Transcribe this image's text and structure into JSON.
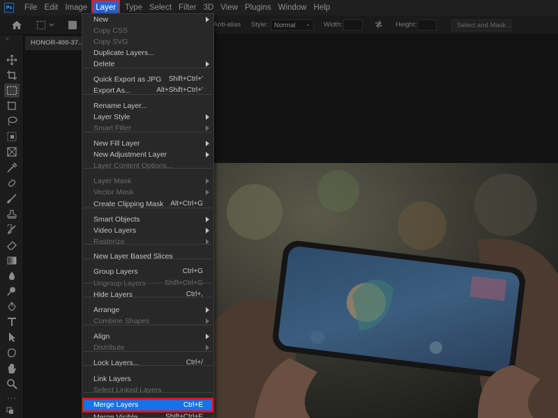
{
  "menubar": {
    "logo": "Ps",
    "items": [
      "File",
      "Edit",
      "Image",
      "Layer",
      "Type",
      "Select",
      "Filter",
      "3D",
      "View",
      "Plugins",
      "Window",
      "Help"
    ],
    "active_item": "Layer"
  },
  "options_bar": {
    "anti_alias_label": "Anti-alias",
    "style_label": "Style:",
    "style_value": "Normal",
    "width_label": "Width:",
    "height_label": "Height:",
    "select_mask_label": "Select and Mask..."
  },
  "document": {
    "tab_title": "HONOR-400-37..."
  },
  "layer_menu": {
    "items": [
      {
        "label": "New",
        "shortcut": "",
        "submenu": true,
        "disabled": false
      },
      {
        "label": "Copy CSS",
        "shortcut": "",
        "submenu": false,
        "disabled": true
      },
      {
        "label": "Copy SVG",
        "shortcut": "",
        "submenu": false,
        "disabled": true
      },
      {
        "label": "Duplicate Layers...",
        "shortcut": "",
        "submenu": false,
        "disabled": false
      },
      {
        "label": "Delete",
        "shortcut": "",
        "submenu": true,
        "disabled": false
      },
      {
        "label": "Quick Export as JPG",
        "shortcut": "Shift+Ctrl+'",
        "submenu": false,
        "disabled": false
      },
      {
        "label": "Export As...",
        "shortcut": "Alt+Shift+Ctrl+'",
        "submenu": false,
        "disabled": false
      },
      {
        "label": "Rename Layer...",
        "shortcut": "",
        "submenu": false,
        "disabled": false
      },
      {
        "label": "Layer Style",
        "shortcut": "",
        "submenu": true,
        "disabled": false
      },
      {
        "label": "Smart Filter",
        "shortcut": "",
        "submenu": true,
        "disabled": true
      },
      {
        "label": "New Fill Layer",
        "shortcut": "",
        "submenu": true,
        "disabled": false
      },
      {
        "label": "New Adjustment Layer",
        "shortcut": "",
        "submenu": true,
        "disabled": false
      },
      {
        "label": "Layer Content Options...",
        "shortcut": "",
        "submenu": false,
        "disabled": true
      },
      {
        "label": "Layer Mask",
        "shortcut": "",
        "submenu": true,
        "disabled": true
      },
      {
        "label": "Vector Mask",
        "shortcut": "",
        "submenu": true,
        "disabled": true
      },
      {
        "label": "Create Clipping Mask",
        "shortcut": "Alt+Ctrl+G",
        "submenu": false,
        "disabled": false
      },
      {
        "label": "Smart Objects",
        "shortcut": "",
        "submenu": true,
        "disabled": false
      },
      {
        "label": "Video Layers",
        "shortcut": "",
        "submenu": true,
        "disabled": false
      },
      {
        "label": "Rasterize",
        "shortcut": "",
        "submenu": true,
        "disabled": true
      },
      {
        "label": "New Layer Based Slices",
        "shortcut": "",
        "submenu": false,
        "disabled": false
      },
      {
        "label": "Group Layers",
        "shortcut": "Ctrl+G",
        "submenu": false,
        "disabled": false
      },
      {
        "label": "Ungroup Layers",
        "shortcut": "Shift+Ctrl+G",
        "submenu": false,
        "disabled": true
      },
      {
        "label": "Hide Layers",
        "shortcut": "Ctrl+,",
        "submenu": false,
        "disabled": false
      },
      {
        "label": "Arrange",
        "shortcut": "",
        "submenu": true,
        "disabled": false
      },
      {
        "label": "Combine Shapes",
        "shortcut": "",
        "submenu": true,
        "disabled": true
      },
      {
        "label": "Align",
        "shortcut": "",
        "submenu": true,
        "disabled": false
      },
      {
        "label": "Distribute",
        "shortcut": "",
        "submenu": true,
        "disabled": true
      },
      {
        "label": "Lock Layers...",
        "shortcut": "Ctrl+/",
        "submenu": false,
        "disabled": false
      },
      {
        "label": "Link Layers",
        "shortcut": "",
        "submenu": false,
        "disabled": false
      },
      {
        "label": "Select Linked Layers",
        "shortcut": "",
        "submenu": false,
        "disabled": true
      },
      {
        "label": "Merge Layers",
        "shortcut": "Ctrl+E",
        "submenu": false,
        "disabled": false,
        "highlighted": true
      },
      {
        "label": "Merge Visible",
        "shortcut": "Shift+Ctrl+E",
        "submenu": false,
        "disabled": false
      }
    ]
  },
  "toolbar": {
    "tools": [
      "move-tool",
      "crop-tool",
      "rectangular-marquee-tool",
      "frame-tool",
      "lasso-tool",
      "object-selection-tool",
      "patch-tool",
      "eyedropper-tool",
      "healing-brush-tool",
      "brush-tool",
      "clone-stamp-tool",
      "history-brush-tool",
      "eraser-tool",
      "gradient-tool",
      "blur-tool",
      "dodge-tool",
      "pen-tool",
      "type-tool",
      "path-selection-tool",
      "rectangle-tool",
      "hand-tool",
      "zoom-tool",
      "more-tools"
    ],
    "selected_tool": "rectangular-marquee-tool"
  },
  "colors": {
    "accent": "#1473e6",
    "annotation_red": "#e81515",
    "menu_bg": "#282828",
    "app_bg": "#121212"
  }
}
